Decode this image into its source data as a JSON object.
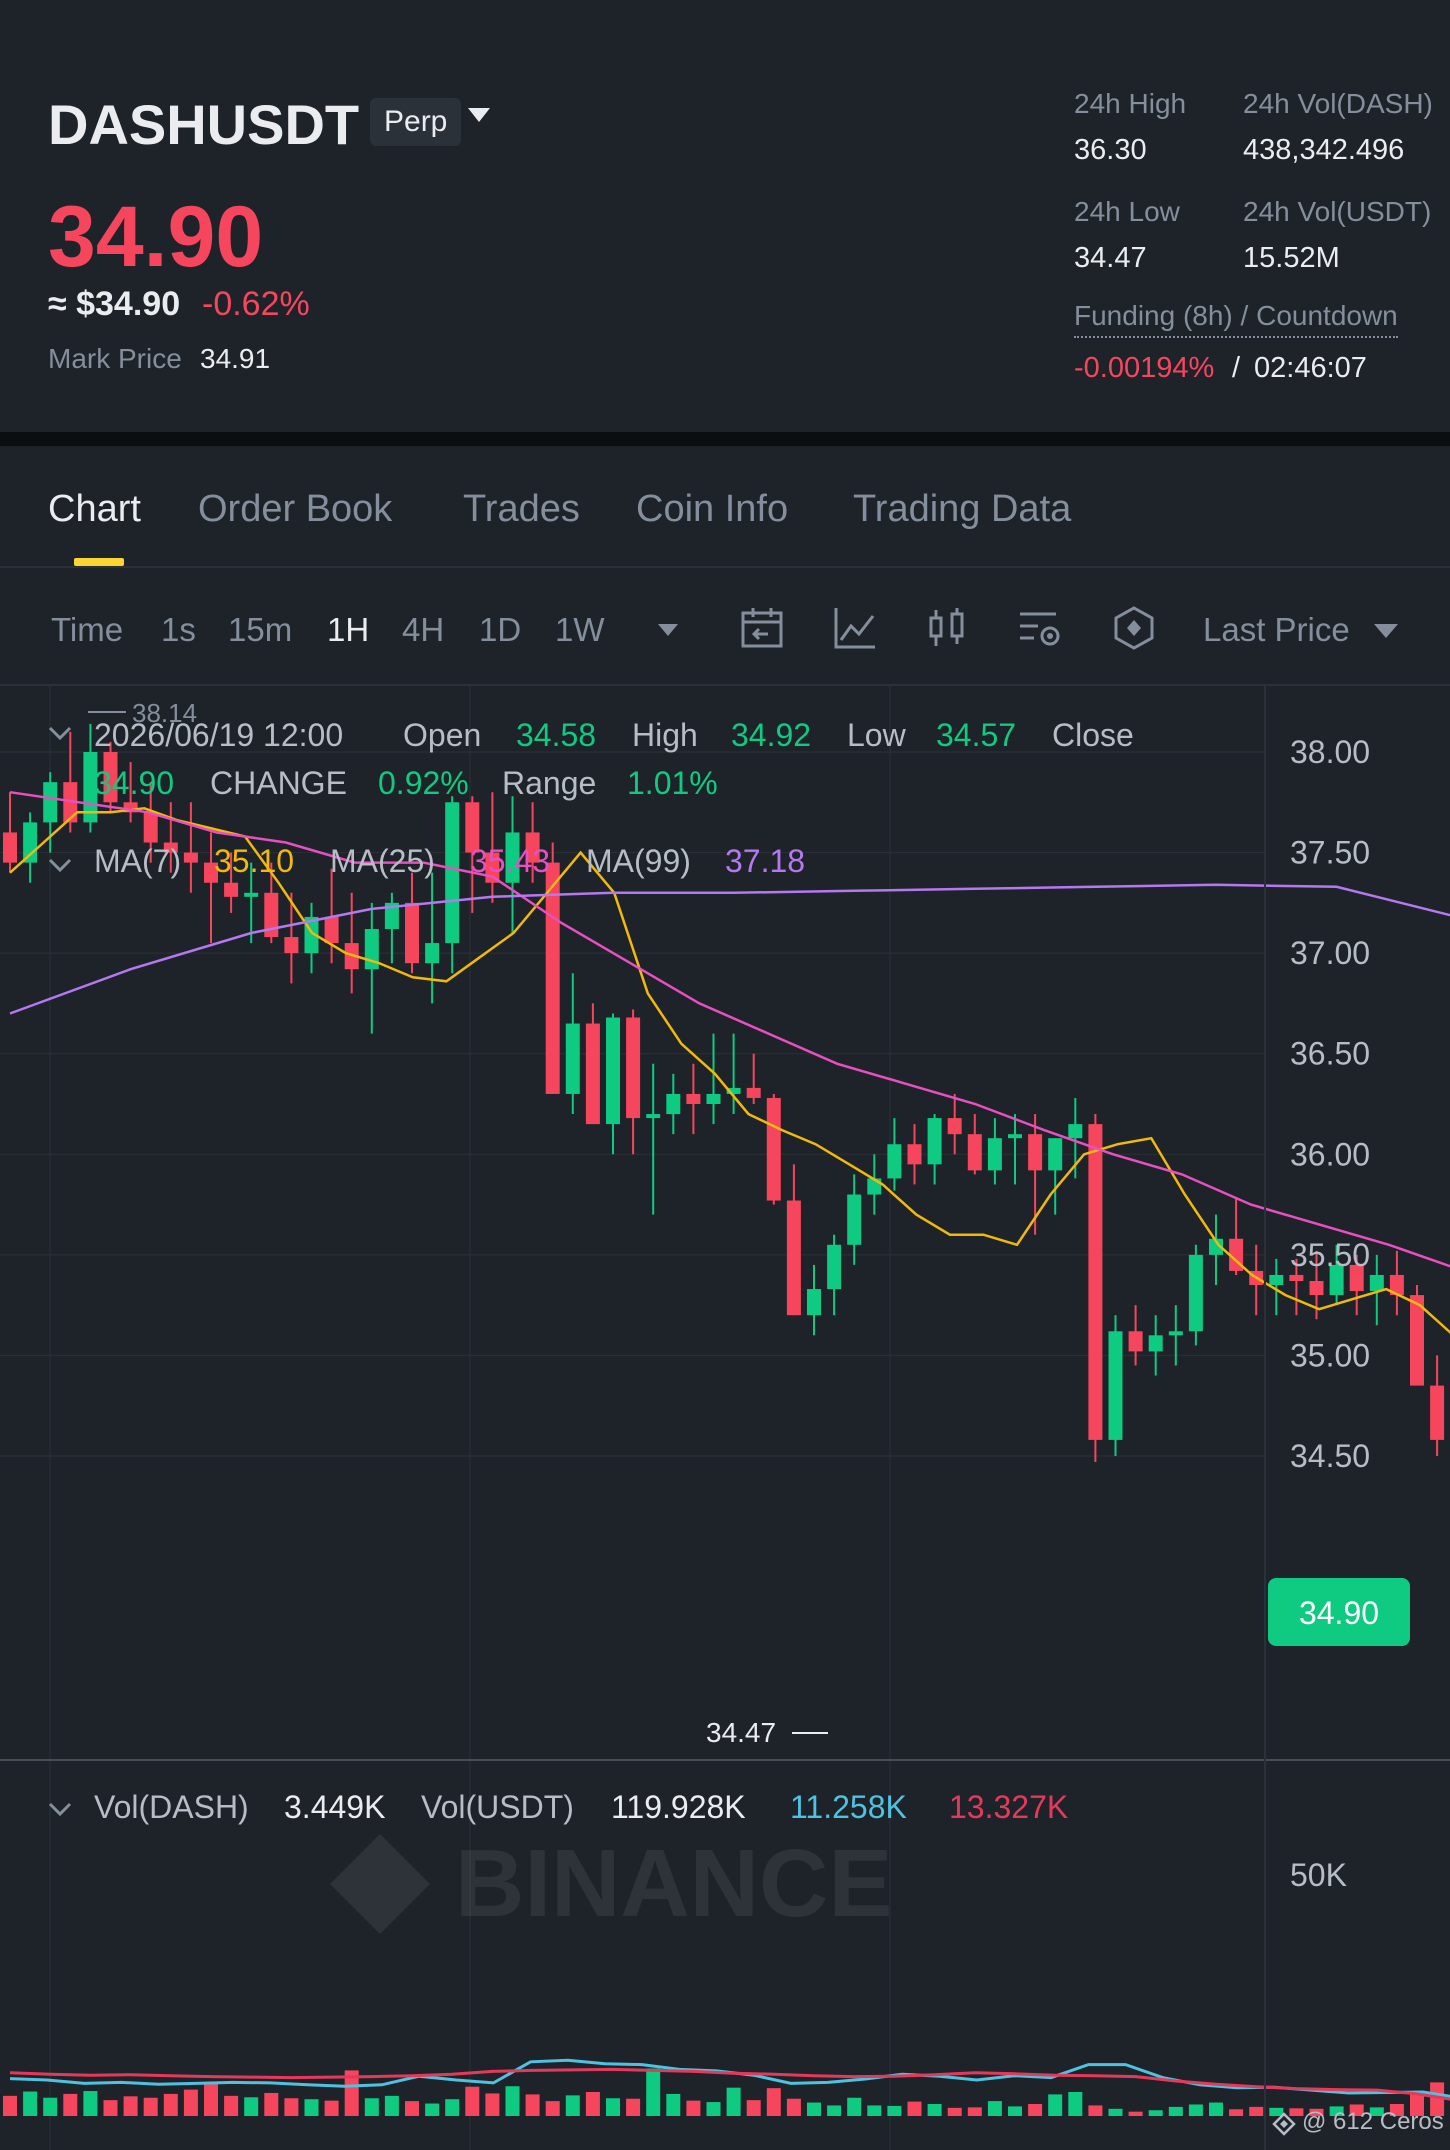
{
  "header": {
    "symbol": "DASHUSDT",
    "contract_type": "Perp",
    "last_price": "34.90",
    "usd_price": "≈ $34.90",
    "change_pct": "-0.62%",
    "mark_price_label": "Mark Price",
    "mark_price": "34.91",
    "stats": {
      "high_label": "24h High",
      "high": "36.30",
      "vol_dash_label": "24h Vol(DASH)",
      "vol_dash": "438,342.496",
      "low_label": "24h Low",
      "low": "34.47",
      "vol_usdt_label": "24h Vol(USDT)",
      "vol_usdt": "15.52M"
    },
    "funding_label": "Funding (8h) / Countdown",
    "funding_rate": "-0.00194%",
    "funding_sep": "/",
    "countdown": "02:46:07",
    "colors": {
      "up": "#0ecb81",
      "down": "#f6465d",
      "accent": "#fcd535"
    }
  },
  "tabs": [
    {
      "label": "Chart",
      "active": true
    },
    {
      "label": "Order Book",
      "active": false
    },
    {
      "label": "Trades",
      "active": false
    },
    {
      "label": "Coin Info",
      "active": false
    },
    {
      "label": "Trading Data",
      "active": false
    }
  ],
  "toolbar": {
    "time_label": "Time",
    "intervals": [
      "1s",
      "15m",
      "1H",
      "4H",
      "1D",
      "1W"
    ],
    "active_interval": "1H",
    "icons": [
      "calendar-icon",
      "indicator-chart-icon",
      "candle-style-icon",
      "chart-settings-icon",
      "hexagon-tools-icon"
    ],
    "price_type": "Last Price"
  },
  "chart_data": {
    "type": "candlestick",
    "ohlc_legend": {
      "datetime": "2026/06/19 12:00",
      "open_label": "Open",
      "open": "34.58",
      "high_label": "High",
      "high": "34.92",
      "low_label": "Low",
      "low": "34.57",
      "close_label": "Close",
      "close": "34.90",
      "change_label": "CHANGE",
      "change": "0.92%",
      "range_label": "Range",
      "range": "1.01%"
    },
    "ma_legend": [
      {
        "label": "MA(7)",
        "value": "35.10",
        "color": "#f0b90b"
      },
      {
        "label": "MA(25)",
        "value": "35.43",
        "color": "#e84fc0"
      },
      {
        "label": "MA(99)",
        "value": "37.18",
        "color": "#b478f0"
      }
    ],
    "price_axis": {
      "ticks": [
        "38.00",
        "37.50",
        "37.00",
        "36.50",
        "36.00",
        "35.50",
        "35.00",
        "34.50"
      ],
      "min": 34.35,
      "max": 38.2
    },
    "high_marker": "38.14",
    "low_marker": "34.47",
    "current_price_tag": "34.90",
    "watermark": "BINANCE",
    "candles": [
      [
        37.6,
        37.8,
        37.4,
        37.45
      ],
      [
        37.45,
        37.7,
        37.35,
        37.65
      ],
      [
        37.65,
        37.9,
        37.5,
        37.85
      ],
      [
        37.85,
        38.1,
        37.6,
        37.65
      ],
      [
        37.65,
        38.14,
        37.6,
        38.0
      ],
      [
        38.0,
        38.05,
        37.7,
        37.75
      ],
      [
        37.75,
        37.95,
        37.65,
        37.7
      ],
      [
        37.7,
        37.85,
        37.45,
        37.55
      ],
      [
        37.55,
        37.75,
        37.4,
        37.5
      ],
      [
        37.5,
        37.75,
        37.3,
        37.45
      ],
      [
        37.45,
        37.6,
        37.05,
        37.35
      ],
      [
        37.35,
        37.5,
        37.2,
        37.28
      ],
      [
        37.28,
        37.45,
        37.05,
        37.3
      ],
      [
        37.3,
        37.45,
        37.05,
        37.08
      ],
      [
        37.08,
        37.3,
        36.85,
        37.0
      ],
      [
        37.0,
        37.25,
        36.9,
        37.18
      ],
      [
        37.18,
        37.42,
        36.95,
        37.05
      ],
      [
        37.05,
        37.3,
        36.8,
        36.92
      ],
      [
        36.92,
        37.25,
        36.6,
        37.12
      ],
      [
        37.12,
        37.3,
        36.95,
        37.25
      ],
      [
        37.25,
        37.4,
        36.9,
        36.95
      ],
      [
        36.95,
        37.4,
        36.75,
        37.05
      ],
      [
        37.05,
        37.78,
        36.9,
        37.75
      ],
      [
        37.75,
        37.78,
        37.2,
        37.5
      ],
      [
        37.5,
        37.8,
        37.25,
        37.35
      ],
      [
        37.35,
        37.78,
        37.1,
        37.6
      ],
      [
        37.6,
        37.75,
        37.35,
        37.45
      ],
      [
        37.45,
        37.55,
        36.3,
        36.3
      ],
      [
        36.3,
        36.9,
        36.2,
        36.65
      ],
      [
        36.65,
        36.75,
        36.2,
        36.15
      ],
      [
        36.15,
        36.7,
        36.0,
        36.68
      ],
      [
        36.68,
        36.72,
        36.0,
        36.18
      ],
      [
        36.18,
        36.45,
        35.7,
        36.2
      ],
      [
        36.2,
        36.4,
        36.1,
        36.3
      ],
      [
        36.3,
        36.45,
        36.1,
        36.25
      ],
      [
        36.25,
        36.6,
        36.15,
        36.3
      ],
      [
        36.3,
        36.6,
        36.2,
        36.33
      ],
      [
        36.33,
        36.5,
        36.25,
        36.28
      ],
      [
        36.28,
        36.3,
        35.75,
        35.77
      ],
      [
        35.77,
        35.95,
        35.2,
        35.2
      ],
      [
        35.2,
        35.45,
        35.1,
        35.33
      ],
      [
        35.33,
        35.6,
        35.2,
        35.55
      ],
      [
        35.55,
        35.9,
        35.45,
        35.8
      ],
      [
        35.8,
        36.0,
        35.7,
        35.88
      ],
      [
        35.88,
        36.18,
        35.82,
        36.05
      ],
      [
        36.05,
        36.15,
        35.85,
        35.95
      ],
      [
        35.95,
        36.2,
        35.85,
        36.18
      ],
      [
        36.18,
        36.3,
        36.0,
        36.1
      ],
      [
        36.1,
        36.2,
        35.9,
        35.92
      ],
      [
        35.92,
        36.18,
        35.85,
        36.08
      ],
      [
        36.08,
        36.2,
        35.85,
        36.1
      ],
      [
        36.1,
        36.2,
        35.6,
        35.92
      ],
      [
        35.92,
        36.08,
        35.7,
        36.08
      ],
      [
        36.08,
        36.28,
        35.88,
        36.15
      ],
      [
        36.15,
        36.2,
        34.47,
        34.58
      ],
      [
        34.58,
        35.2,
        34.5,
        35.12
      ],
      [
        35.12,
        35.25,
        34.95,
        35.02
      ],
      [
        35.02,
        35.2,
        34.9,
        35.1
      ],
      [
        35.1,
        35.25,
        34.95,
        35.12
      ],
      [
        35.12,
        35.55,
        35.05,
        35.5
      ],
      [
        35.5,
        35.7,
        35.35,
        35.58
      ],
      [
        35.58,
        35.78,
        35.4,
        35.42
      ],
      [
        35.42,
        35.55,
        35.2,
        35.35
      ],
      [
        35.35,
        35.48,
        35.2,
        35.4
      ],
      [
        35.4,
        35.48,
        35.2,
        35.37
      ],
      [
        35.37,
        35.52,
        35.18,
        35.3
      ],
      [
        35.3,
        35.55,
        35.25,
        35.45
      ],
      [
        35.45,
        35.5,
        35.2,
        35.32
      ],
      [
        35.32,
        35.5,
        35.15,
        35.4
      ],
      [
        35.4,
        35.52,
        35.2,
        35.3
      ],
      [
        35.3,
        35.35,
        34.9,
        34.85
      ],
      [
        34.85,
        35.0,
        34.5,
        34.58
      ],
      [
        34.58,
        35.0,
        34.55,
        34.9
      ]
    ],
    "ma7": [
      37.4,
      37.55,
      37.7,
      37.7,
      37.72,
      37.66,
      37.62,
      37.58,
      37.35,
      37.1,
      37.0,
      36.95,
      36.88,
      36.86,
      36.98,
      37.1,
      37.3,
      37.5,
      37.3,
      36.8,
      36.55,
      36.4,
      36.2,
      36.12,
      36.05,
      35.95,
      35.85,
      35.7,
      35.6,
      35.6,
      35.55,
      35.8,
      36.0,
      36.05,
      36.08,
      35.8,
      35.55,
      35.4,
      35.3,
      35.23,
      35.28,
      35.33,
      35.25,
      35.1
    ],
    "ma25": [
      37.8,
      37.75,
      37.7,
      37.6,
      37.55,
      37.45,
      37.45,
      37.38,
      37.15,
      36.95,
      36.75,
      36.6,
      36.45,
      36.35,
      36.25,
      36.12,
      36.0,
      35.9,
      35.75,
      35.65,
      35.55,
      35.43
    ],
    "ma99": [
      36.7,
      36.92,
      37.1,
      37.22,
      37.28,
      37.3,
      37.3,
      37.31,
      37.32,
      37.33,
      37.34,
      37.33,
      37.18
    ],
    "volume_legend": {
      "dash_label": "Vol(DASH)",
      "dash": "3.449K",
      "usdt_label": "Vol(USDT)",
      "usdt": "119.928K",
      "ma1": "11.258K",
      "ma1_color": "#4fc2e0",
      "ma2": "13.327K",
      "ma2_color": "#e5395c"
    },
    "volume_axis": {
      "ticks": [
        "50K"
      ],
      "max": 60000
    },
    "volumes": [
      4200,
      5100,
      3800,
      4600,
      5200,
      3300,
      4100,
      3800,
      4600,
      5500,
      6800,
      4200,
      3900,
      4800,
      3700,
      3500,
      3200,
      9500,
      3700,
      4200,
      3100,
      2600,
      3500,
      6100,
      4700,
      6200,
      4500,
      3100,
      4300,
      5000,
      3700,
      3600,
      9900,
      4600,
      3200,
      2900,
      5900,
      3300,
      5800,
      3600,
      2800,
      2200,
      3800,
      2200,
      2100,
      3000,
      2500,
      1700,
      1800,
      3100,
      2000,
      2500,
      4500,
      5000,
      2200,
      1500,
      900,
      1200,
      1900,
      2400,
      2800,
      1400,
      1900,
      1700,
      1600,
      1500,
      2000,
      2400,
      1800,
      2500,
      5000,
      7000,
      17000
    ],
    "vol_ma1": [
      7800,
      7500,
      6800,
      7000,
      6600,
      6800,
      7000,
      6900,
      6500,
      6200,
      6500,
      8300,
      7500,
      6900,
      11300,
      11600,
      10900,
      10700,
      9700,
      9400,
      8500,
      6800,
      7000,
      7700,
      8700,
      8300,
      7500,
      8400,
      8000,
      10700,
      10700,
      8000,
      6500,
      5900,
      6000,
      5400,
      4800,
      4900,
      5000,
      3800
    ],
    "vol_ma2": [
      9000,
      8700,
      8500,
      8600,
      8400,
      8200,
      8100,
      8000,
      8100,
      8200,
      8400,
      8700,
      9300,
      9500,
      9600,
      9700,
      9500,
      9300,
      8900,
      8700,
      8400,
      8200,
      8300,
      8600,
      9000,
      8800,
      8500,
      8400,
      8200,
      7300,
      6600,
      6100,
      5700,
      5500,
      5400,
      4600,
      3300
    ]
  },
  "footer": {
    "label": "@ 612 Ceros"
  }
}
